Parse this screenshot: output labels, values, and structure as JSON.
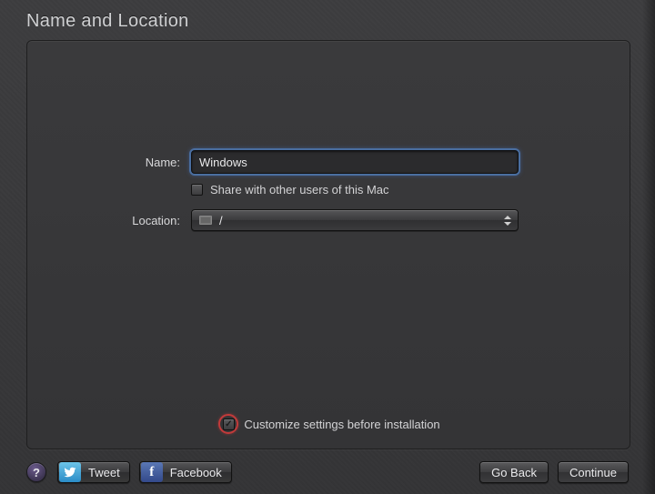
{
  "page_title": "Name and Location",
  "form": {
    "name_label": "Name:",
    "name_value": "Windows",
    "share_checkbox": {
      "label": "Share with other users of this Mac",
      "checked": false
    },
    "location_label": "Location:",
    "location_value": "/"
  },
  "customize": {
    "label": "Customize settings before installation",
    "checked": true
  },
  "footer": {
    "help": "?",
    "tweet": "Tweet",
    "facebook": "Facebook",
    "go_back": "Go Back",
    "continue": "Continue"
  }
}
